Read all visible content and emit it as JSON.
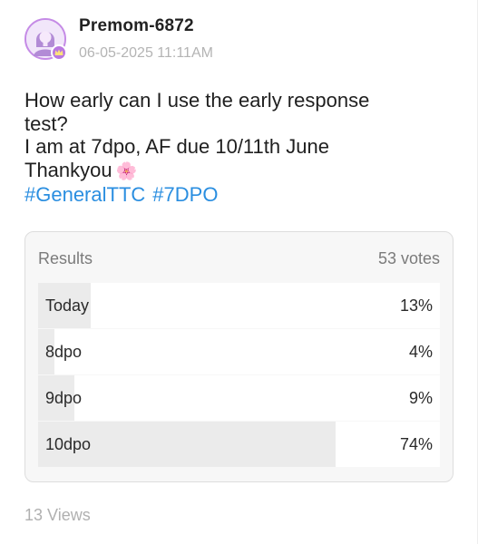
{
  "post": {
    "username": "Premom-6872",
    "timestamp": "06-05-2025 11:11AM",
    "body_lines": [
      "How early can I use the early response",
      "test?",
      "I am at 7dpo, AF due 10/11th June",
      "Thankyou"
    ],
    "emoji": "🌸",
    "hashtags": [
      "#GeneralTTC",
      "#7DPO"
    ],
    "avatar_icon": "user-avatar-icon",
    "badge_icon": "crown-icon",
    "colors": {
      "hashtag": "#2a8ee0",
      "avatar_ring": "#c58be6",
      "badge": "#b978e0"
    }
  },
  "poll": {
    "results_label": "Results",
    "votes_label": "53 votes",
    "options": [
      {
        "label": "Today",
        "percent_label": "13%",
        "percent": 13
      },
      {
        "label": "8dpo",
        "percent_label": "4%",
        "percent": 4
      },
      {
        "label": "9dpo",
        "percent_label": "9%",
        "percent": 9
      },
      {
        "label": "10dpo",
        "percent_label": "74%",
        "percent": 74
      }
    ]
  },
  "footer": {
    "views_label": "13 Views"
  }
}
